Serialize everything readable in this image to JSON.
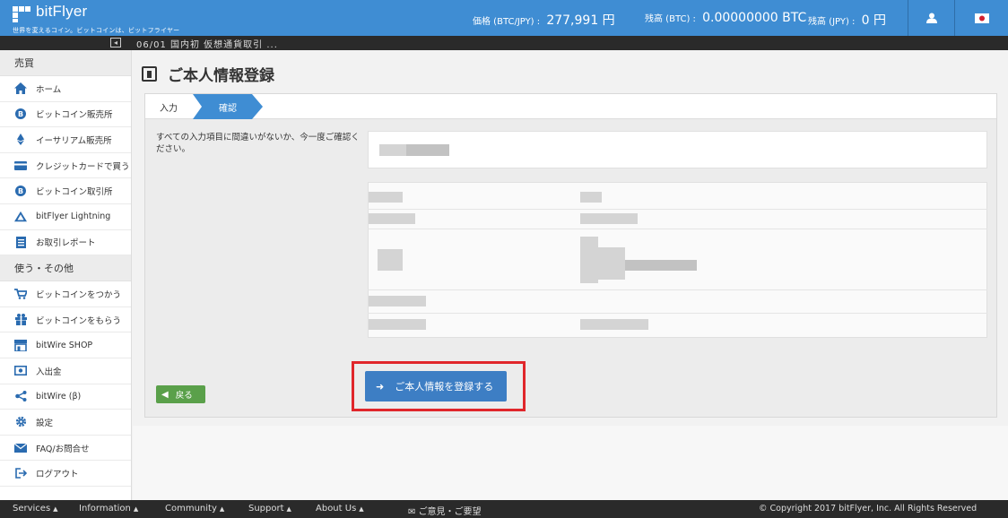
{
  "header": {
    "logo_text": "bitFlyer",
    "tagline": "世界を変えるコイン。ビットコインは、ビットフライヤー",
    "price_label": "価格 (BTC/JPY) :",
    "price_value": "277,991 円",
    "btc_balance_label": "残高 (BTC) :",
    "btc_balance_value": "0.00000000 BTC",
    "jpy_balance_label": "残高 (JPY) :",
    "jpy_balance_value": "0 円"
  },
  "ticker": {
    "text": "06/01 国内初 仮想通貨取引 ..."
  },
  "sidebar": {
    "section_trade": "売買",
    "trade_items": [
      {
        "label": "ホーム"
      },
      {
        "label": "ビットコイン販売所"
      },
      {
        "label": "イーサリアム販売所"
      },
      {
        "label": "クレジットカードで買う"
      },
      {
        "label": "ビットコイン取引所"
      },
      {
        "label": "bitFlyer Lightning"
      },
      {
        "label": "お取引レポート"
      }
    ],
    "section_use": "使う・その他",
    "use_items": [
      {
        "label": "ビットコインをつかう"
      },
      {
        "label": "ビットコインをもらう"
      },
      {
        "label": "bitWire SHOP"
      },
      {
        "label": "入出金"
      },
      {
        "label": "bitWire (β)"
      },
      {
        "label": "設定"
      },
      {
        "label": "FAQ/お問合せ"
      },
      {
        "label": "ログアウト"
      }
    ]
  },
  "main": {
    "title": "ご本人情報登録",
    "steps": [
      {
        "label": "入力"
      },
      {
        "label": "確認"
      }
    ],
    "instructions": "すべての入力項目に間違いがないか、今一度ご確認ください。",
    "back_button": "戻る",
    "submit_button": "ご本人情報を登録する"
  },
  "footer": {
    "services": "Services",
    "information": "Information",
    "community": "Community",
    "support": "Support",
    "about": "About Us",
    "feedback": "ご意見・ご要望",
    "copyright": "© Copyright 2017 bitFlyer, Inc. All Rights Reserved"
  },
  "colors": {
    "header_bg": "#3f8dd3",
    "step_active": "#3f8dd3",
    "submit_button": "#3d7ec4",
    "back_button": "#5aa04a",
    "highlight_border": "#e0262b"
  }
}
